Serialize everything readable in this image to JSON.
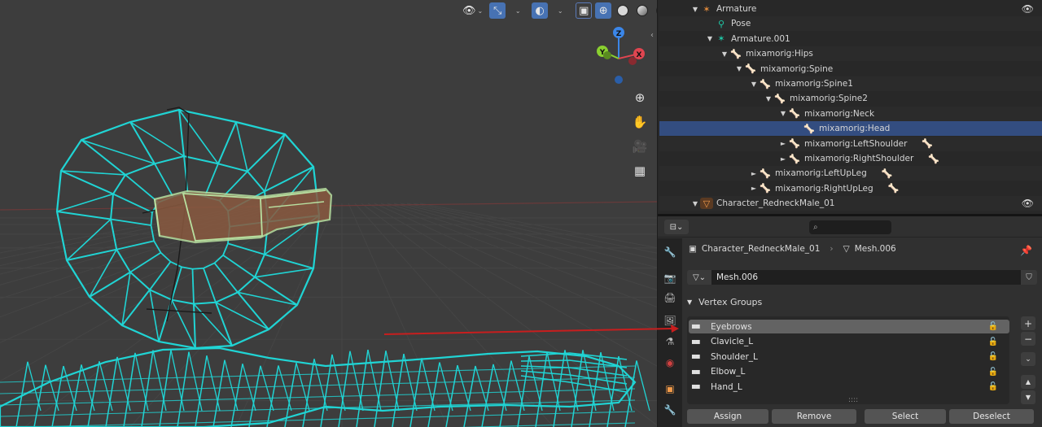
{
  "viewport": {
    "header_icons": [
      "visibility-icon",
      "gizmo-icon",
      "overlay-icon",
      "xray-icon",
      "wireframe-shading",
      "solid-shading",
      "material-shading",
      "rendered-shading"
    ],
    "axes": {
      "z": "Z",
      "y": "Y",
      "x": "X"
    },
    "tools": [
      "zoom-icon",
      "hand-icon",
      "camera-icon",
      "grid-icon"
    ],
    "colors": {
      "wire": "#20d4d4",
      "selected_mesh": "#b8e0a0",
      "background": "#3d3d3d",
      "x_axis": "#e04550",
      "y_axis": "#8ad030",
      "z_axis": "#3b86e8"
    }
  },
  "outliner": {
    "rows": [
      {
        "indent": 0,
        "expand": "open",
        "icon": "armature",
        "label": "Armature",
        "eye": true
      },
      {
        "indent": 1,
        "expand": "none",
        "icon": "pose",
        "label": "Pose"
      },
      {
        "indent": 1,
        "expand": "open",
        "icon": "armature-data",
        "label": "Armature.001"
      },
      {
        "indent": 2,
        "expand": "open",
        "icon": "bone",
        "label": "mixamorig:Hips"
      },
      {
        "indent": 3,
        "expand": "open",
        "icon": "bone",
        "label": "mixamorig:Spine"
      },
      {
        "indent": 4,
        "expand": "open",
        "icon": "bone",
        "label": "mixamorig:Spine1"
      },
      {
        "indent": 5,
        "expand": "open",
        "icon": "bone",
        "label": "mixamorig:Spine2"
      },
      {
        "indent": 6,
        "expand": "open",
        "icon": "bone",
        "label": "mixamorig:Neck"
      },
      {
        "indent": 7,
        "expand": "none",
        "icon": "bone",
        "label": "mixamorig:Head",
        "selected": true
      },
      {
        "indent": 6,
        "expand": "closed",
        "icon": "bone",
        "label": "mixamorig:LeftShoulder",
        "extra": true
      },
      {
        "indent": 6,
        "expand": "closed",
        "icon": "bone",
        "label": "mixamorig:RightShoulder",
        "extra": true
      },
      {
        "indent": 4,
        "expand": "closed",
        "icon": "bone",
        "label": "mixamorig:LeftUpLeg",
        "extra": true
      },
      {
        "indent": 4,
        "expand": "closed",
        "icon": "bone",
        "label": "mixamorig:RightUpLeg",
        "extra": true
      },
      {
        "indent": 0,
        "expand": "open",
        "icon": "mesh-object",
        "label": "Character_RedneckMale_01",
        "eye": true
      }
    ]
  },
  "properties": {
    "breadcrumb": {
      "object": "Character_RedneckMale_01",
      "mesh": "Mesh.006"
    },
    "mesh_name": "Mesh.006",
    "panel_title": "Vertex Groups",
    "vertex_groups": [
      "Eyebrows",
      "Clavicle_L",
      "Shoulder_L",
      "Elbow_L",
      "Hand_L"
    ],
    "active_group": "Eyebrows",
    "buttons": {
      "assign": "Assign",
      "remove": "Remove",
      "select": "Select",
      "deselect": "Deselect"
    }
  }
}
